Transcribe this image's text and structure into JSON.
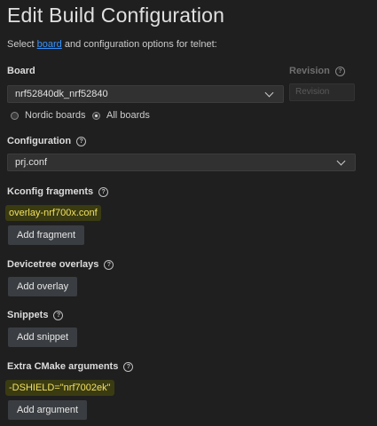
{
  "page": {
    "title": "Edit Build Configuration",
    "subtitle_pre": "Select ",
    "subtitle_link": "board",
    "subtitle_post": " and configuration options for telnet:"
  },
  "board": {
    "label": "Board",
    "value": "nrf52840dk_nrf52840",
    "revision_label": "Revision",
    "revision_placeholder": "Revision",
    "radio_nordic": "Nordic boards",
    "radio_all": "All boards",
    "selected": "All boards"
  },
  "configuration": {
    "label": "Configuration",
    "value": "prj.conf"
  },
  "kconfig": {
    "label": "Kconfig fragments",
    "item": "overlay-nrf700x.conf",
    "button": "Add fragment"
  },
  "devicetree": {
    "label": "Devicetree overlays",
    "button": "Add overlay"
  },
  "snippets": {
    "label": "Snippets",
    "button": "Add snippet"
  },
  "cmake": {
    "label": "Extra CMake arguments",
    "item": "-DSHIELD=\"nrf7002ek\"",
    "button": "Add argument"
  },
  "icons": {
    "help": "help-circle-icon",
    "dropdown": "chevron-down-icon"
  },
  "colors": {
    "link": "#3794ff",
    "highlight_text": "#f0e060",
    "highlight_bg": "#3b3b12",
    "background": "#1f1f1f"
  }
}
